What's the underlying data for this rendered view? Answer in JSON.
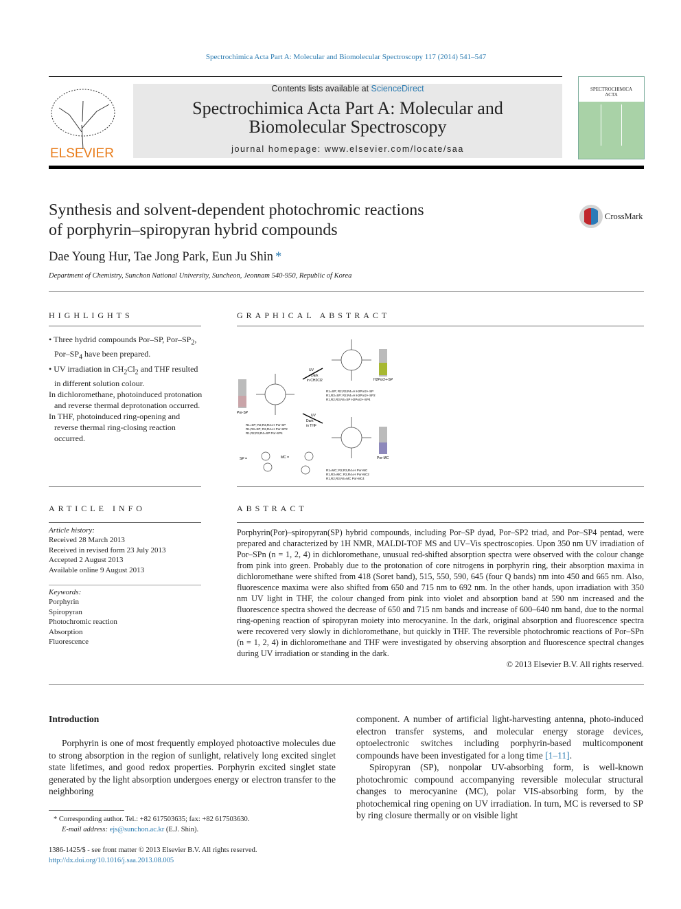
{
  "header": {
    "citation": "Spectrochimica Acta Part A: Molecular and Biomolecular Spectroscopy 117 (2014) 541–547",
    "contents_prefix": "Contents lists available at ",
    "contents_link": "ScienceDirect",
    "journal_title_1": "Spectrochimica Acta Part A: Molecular and",
    "journal_title_2": "Biomolecular Spectroscopy",
    "homepage_prefix": "journal homepage: ",
    "homepage_url": "www.elsevier.com/locate/saa",
    "publisher": "ELSEVIER",
    "cover_title_1": "SPECTROCHIMICA",
    "cover_title_2": "ACTA"
  },
  "article": {
    "title_1": "Synthesis and solvent-dependent photochromic reactions",
    "title_2": "of porphyrin–spiropyran hybrid compounds",
    "authors": "Dae Young Hur, Tae Jong Park, Eun Ju Shin",
    "author_mark": "*",
    "affiliation": "Department of Chemistry, Sunchon National University, Suncheon, Jeonnam 540-950, Republic of Korea",
    "crossmark": "CrossMark"
  },
  "highlights": {
    "heading": "HIGHLIGHTS",
    "items": [
      "Three hydrid compounds Por–SP, Por–SP2, Por–SP4 have been prepared.",
      "UV irradiation in CH2Cl2 and THF resulted in different solution colour.",
      "In dichloromethane, photoinduced protonation and reverse thermal deprotonation occurred.",
      "In THF, photoinduced ring-opening and reverse thermal ring-closing reaction occurred."
    ]
  },
  "graphical_abstract": {
    "heading": "GRAPHICAL ABSTRACT",
    "labels": {
      "por_sp": "Por-SP",
      "h2por_sp": "H2Por2+-SP",
      "por_mc": "Por-MC",
      "uv": "UV",
      "dark": "Dark",
      "in_ch2cl2": "in CH2Cl2",
      "in_thf": "in THF",
      "sp_def": "SP =",
      "mc_def": "MC ="
    },
    "left_table": [
      "R1=SP; R2,R3,R4=H   Por-SP",
      "R1,R3=SP; R2,R4=H   Por-SP2",
      "R1,R2,R3,R4=SP   Por-SP4"
    ],
    "top_table": [
      "R1=SP; R2,R3,R4=H   H2Por2+-SP",
      "R1,R3=SP; R2,R4=H   H2Por2+-SP2",
      "R1,R2,R3,R4=SP   H2Por2+-SP4"
    ],
    "bottom_table": [
      "R1=MC; R2,R3,R4=H   Por-MC",
      "R1,R3=MC; R2,R4=H   Por-MC2",
      "R1,R2,R3,R4=MC   Por-MC4"
    ],
    "vial_colors": {
      "pink": "#c9a4a8",
      "green": "#a7b832",
      "violet": "#8d88bb"
    }
  },
  "article_info": {
    "heading": "ARTICLE INFO",
    "history_label": "Article history:",
    "history": [
      "Received 28 March 2013",
      "Received in revised form 23 July 2013",
      "Accepted 2 August 2013",
      "Available online 9 August 2013"
    ],
    "keywords_label": "Keywords:",
    "keywords": [
      "Porphyrin",
      "Spiropyran",
      "Photochromic reaction",
      "Absorption",
      "Fluorescence"
    ]
  },
  "abstract": {
    "heading": "ABSTRACT",
    "text": "Porphyrin(Por)–spiropyran(SP) hybrid compounds, including Por–SP dyad, Por–SP2 triad, and Por–SP4 pentad, were prepared and characterized by 1H NMR, MALDI-TOF MS and UV–Vis spectroscopies. Upon 350 nm UV irradiation of Por–SPn (n = 1, 2, 4) in dichloromethane, unusual red-shifted absorption spectra were observed with the colour change from pink into green. Probably due to the protonation of core nitrogens in porphyrin ring, their absorption maxima in dichloromethane were shifted from 418 (Soret band), 515, 550, 590, 645 (four Q bands) nm into 450 and 665 nm. Also, fluorescence maxima were also shifted from 650 and 715 nm to 692 nm. In the other hands, upon irradiation with 350 nm UV light in THF, the colour changed from pink into violet and absorption band at 590 nm increased and the fluorescence spectra showed the decrease of 650 and 715 nm bands and increase of 600–640 nm band, due to the normal ring-opening reaction of spiropyran moiety into merocyanine. In the dark, original absorption and fluorescence spectra were recovered very slowly in dichloromethane, but quickly in THF. The reversible photochromic reactions of Por–SPn (n = 1, 2, 4) in dichloromethane and THF were investigated by observing absorption and fluorescence spectral changes during UV irradiation or standing in the dark.",
    "copyright": "© 2013 Elsevier B.V. All rights reserved."
  },
  "body": {
    "intro_heading": "Introduction",
    "col1_p1": "Porphyrin is one of most frequently employed photoactive molecules due to strong absorption in the region of sunlight, relatively long excited singlet state lifetimes, and good redox properties. Porphyrin excited singlet state generated by the light absorption undergoes energy or electron transfer to the neighboring",
    "col2_p1": "component. A number of artificial light-harvesting antenna, photo-induced electron transfer systems, and molecular energy storage devices, optoelectronic switches including porphyrin-based multicomponent compounds have been investigated for a long time ",
    "col2_ref": "[1–11]",
    "col2_p1_end": ".",
    "col2_p2": "Spiropyran (SP), nonpolar UV-absorbing form, is well-known photochromic compound accompanying reversible molecular structural changes to merocyanine (MC), polar VIS-absorbing form, by the photochemical ring opening on UV irradiation. In turn, MC is reversed to SP by ring closure thermally or on visible light"
  },
  "footnote": {
    "corresponding": "* Corresponding author. Tel.: +82 617503635; fax: +82 617503630.",
    "email_label": "E-mail address: ",
    "email": "ejs@sunchon.ac.kr",
    "email_suffix": " (E.J. Shin).",
    "issn": "1386-1425/$ - see front matter © 2013 Elsevier B.V. All rights reserved.",
    "doi": "http://dx.doi.org/10.1016/j.saa.2013.08.005"
  }
}
